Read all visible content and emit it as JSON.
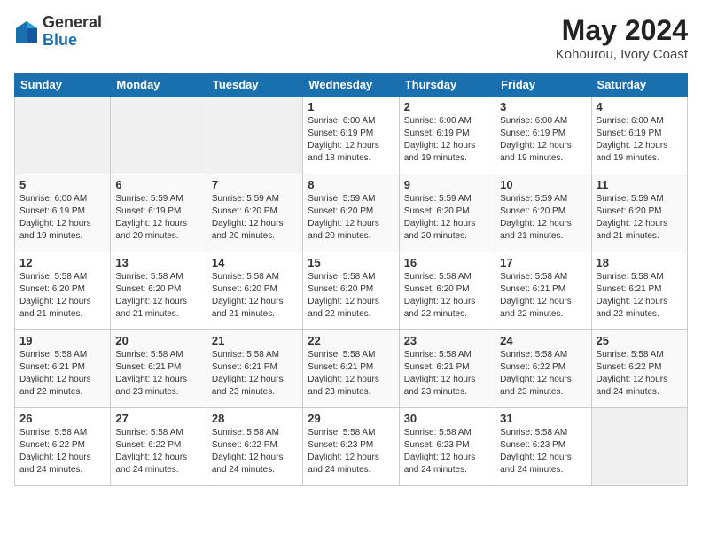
{
  "header": {
    "logo_general": "General",
    "logo_blue": "Blue",
    "title": "May 2024",
    "subtitle": "Kohourou, Ivory Coast"
  },
  "days_of_week": [
    "Sunday",
    "Monday",
    "Tuesday",
    "Wednesday",
    "Thursday",
    "Friday",
    "Saturday"
  ],
  "weeks": [
    [
      {
        "day": "",
        "info": ""
      },
      {
        "day": "",
        "info": ""
      },
      {
        "day": "",
        "info": ""
      },
      {
        "day": "1",
        "info": "Sunrise: 6:00 AM\nSunset: 6:19 PM\nDaylight: 12 hours\nand 18 minutes."
      },
      {
        "day": "2",
        "info": "Sunrise: 6:00 AM\nSunset: 6:19 PM\nDaylight: 12 hours\nand 19 minutes."
      },
      {
        "day": "3",
        "info": "Sunrise: 6:00 AM\nSunset: 6:19 PM\nDaylight: 12 hours\nand 19 minutes."
      },
      {
        "day": "4",
        "info": "Sunrise: 6:00 AM\nSunset: 6:19 PM\nDaylight: 12 hours\nand 19 minutes."
      }
    ],
    [
      {
        "day": "5",
        "info": "Sunrise: 6:00 AM\nSunset: 6:19 PM\nDaylight: 12 hours\nand 19 minutes."
      },
      {
        "day": "6",
        "info": "Sunrise: 5:59 AM\nSunset: 6:19 PM\nDaylight: 12 hours\nand 20 minutes."
      },
      {
        "day": "7",
        "info": "Sunrise: 5:59 AM\nSunset: 6:20 PM\nDaylight: 12 hours\nand 20 minutes."
      },
      {
        "day": "8",
        "info": "Sunrise: 5:59 AM\nSunset: 6:20 PM\nDaylight: 12 hours\nand 20 minutes."
      },
      {
        "day": "9",
        "info": "Sunrise: 5:59 AM\nSunset: 6:20 PM\nDaylight: 12 hours\nand 20 minutes."
      },
      {
        "day": "10",
        "info": "Sunrise: 5:59 AM\nSunset: 6:20 PM\nDaylight: 12 hours\nand 21 minutes."
      },
      {
        "day": "11",
        "info": "Sunrise: 5:59 AM\nSunset: 6:20 PM\nDaylight: 12 hours\nand 21 minutes."
      }
    ],
    [
      {
        "day": "12",
        "info": "Sunrise: 5:58 AM\nSunset: 6:20 PM\nDaylight: 12 hours\nand 21 minutes."
      },
      {
        "day": "13",
        "info": "Sunrise: 5:58 AM\nSunset: 6:20 PM\nDaylight: 12 hours\nand 21 minutes."
      },
      {
        "day": "14",
        "info": "Sunrise: 5:58 AM\nSunset: 6:20 PM\nDaylight: 12 hours\nand 21 minutes."
      },
      {
        "day": "15",
        "info": "Sunrise: 5:58 AM\nSunset: 6:20 PM\nDaylight: 12 hours\nand 22 minutes."
      },
      {
        "day": "16",
        "info": "Sunrise: 5:58 AM\nSunset: 6:20 PM\nDaylight: 12 hours\nand 22 minutes."
      },
      {
        "day": "17",
        "info": "Sunrise: 5:58 AM\nSunset: 6:21 PM\nDaylight: 12 hours\nand 22 minutes."
      },
      {
        "day": "18",
        "info": "Sunrise: 5:58 AM\nSunset: 6:21 PM\nDaylight: 12 hours\nand 22 minutes."
      }
    ],
    [
      {
        "day": "19",
        "info": "Sunrise: 5:58 AM\nSunset: 6:21 PM\nDaylight: 12 hours\nand 22 minutes."
      },
      {
        "day": "20",
        "info": "Sunrise: 5:58 AM\nSunset: 6:21 PM\nDaylight: 12 hours\nand 23 minutes."
      },
      {
        "day": "21",
        "info": "Sunrise: 5:58 AM\nSunset: 6:21 PM\nDaylight: 12 hours\nand 23 minutes."
      },
      {
        "day": "22",
        "info": "Sunrise: 5:58 AM\nSunset: 6:21 PM\nDaylight: 12 hours\nand 23 minutes."
      },
      {
        "day": "23",
        "info": "Sunrise: 5:58 AM\nSunset: 6:21 PM\nDaylight: 12 hours\nand 23 minutes."
      },
      {
        "day": "24",
        "info": "Sunrise: 5:58 AM\nSunset: 6:22 PM\nDaylight: 12 hours\nand 23 minutes."
      },
      {
        "day": "25",
        "info": "Sunrise: 5:58 AM\nSunset: 6:22 PM\nDaylight: 12 hours\nand 24 minutes."
      }
    ],
    [
      {
        "day": "26",
        "info": "Sunrise: 5:58 AM\nSunset: 6:22 PM\nDaylight: 12 hours\nand 24 minutes."
      },
      {
        "day": "27",
        "info": "Sunrise: 5:58 AM\nSunset: 6:22 PM\nDaylight: 12 hours\nand 24 minutes."
      },
      {
        "day": "28",
        "info": "Sunrise: 5:58 AM\nSunset: 6:22 PM\nDaylight: 12 hours\nand 24 minutes."
      },
      {
        "day": "29",
        "info": "Sunrise: 5:58 AM\nSunset: 6:23 PM\nDaylight: 12 hours\nand 24 minutes."
      },
      {
        "day": "30",
        "info": "Sunrise: 5:58 AM\nSunset: 6:23 PM\nDaylight: 12 hours\nand 24 minutes."
      },
      {
        "day": "31",
        "info": "Sunrise: 5:58 AM\nSunset: 6:23 PM\nDaylight: 12 hours\nand 24 minutes."
      },
      {
        "day": "",
        "info": ""
      }
    ]
  ]
}
